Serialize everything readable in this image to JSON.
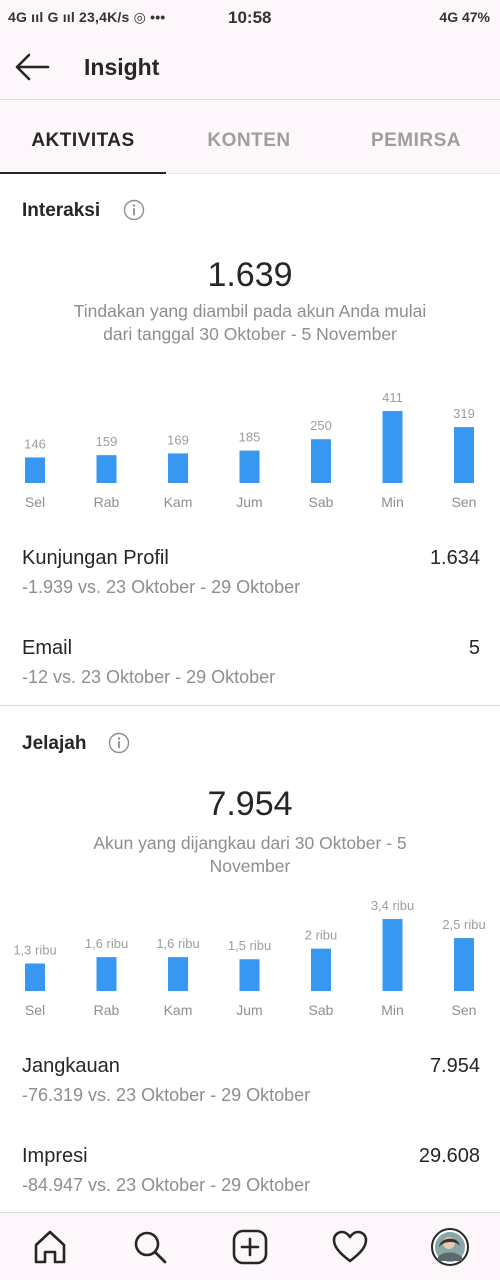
{
  "status_bar": {
    "left": "4G ııl  G ııl  23,4K/s ◎  •••",
    "time": "10:58",
    "right": "4G 47%"
  },
  "header": {
    "title": "Insight"
  },
  "tabs": [
    {
      "label": "AKTIVITAS",
      "active": true
    },
    {
      "label": "KONTEN",
      "active": false
    },
    {
      "label": "PEMIRSA",
      "active": false
    }
  ],
  "interaksi": {
    "title": "Interaksi",
    "total": "1.639",
    "subtitle": "Tindakan yang diambil pada akun Anda mulai dari tanggal 30 Oktober - 5 November",
    "chart_data": {
      "type": "bar",
      "categories": [
        "Sel",
        "Rab",
        "Kam",
        "Jum",
        "Sab",
        "Min",
        "Sen"
      ],
      "values": [
        146,
        159,
        169,
        185,
        250,
        411,
        319
      ],
      "value_labels": [
        "146",
        "159",
        "169",
        "185",
        "250",
        "411",
        "319"
      ],
      "bar_color": "#3897f0"
    },
    "metrics": [
      {
        "label": "Kunjungan Profil",
        "value": "1.634",
        "compare": "-1.939 vs. 23 Oktober - 29 Oktober"
      },
      {
        "label": "Email",
        "value": "5",
        "compare": "-12 vs. 23 Oktober - 29 Oktober"
      }
    ]
  },
  "jelajah": {
    "title": "Jelajah",
    "total": "7.954",
    "subtitle": "Akun yang dijangkau dari 30 Oktober - 5 November",
    "chart_data": {
      "type": "bar",
      "categories": [
        "Sel",
        "Rab",
        "Kam",
        "Jum",
        "Sab",
        "Min",
        "Sen"
      ],
      "values": [
        1300,
        1600,
        1600,
        1500,
        2000,
        3400,
        2500
      ],
      "value_labels": [
        "1,3 ribu",
        "1,6 ribu",
        "1,6 ribu",
        "1,5 ribu",
        "2 ribu",
        "3,4 ribu",
        "2,5 ribu"
      ],
      "bar_color": "#3897f0"
    },
    "metrics": [
      {
        "label": "Jangkauan",
        "value": "7.954",
        "compare": "-76.319 vs. 23 Oktober - 29 Oktober"
      },
      {
        "label": "Impresi",
        "value": "29.608",
        "compare": "-84.947 vs. 23 Oktober - 29 Oktober"
      }
    ]
  },
  "bottom_nav": [
    {
      "icon": "home-icon"
    },
    {
      "icon": "search-icon"
    },
    {
      "icon": "add-post-icon"
    },
    {
      "icon": "heart-icon"
    },
    {
      "icon": "profile-avatar"
    }
  ]
}
